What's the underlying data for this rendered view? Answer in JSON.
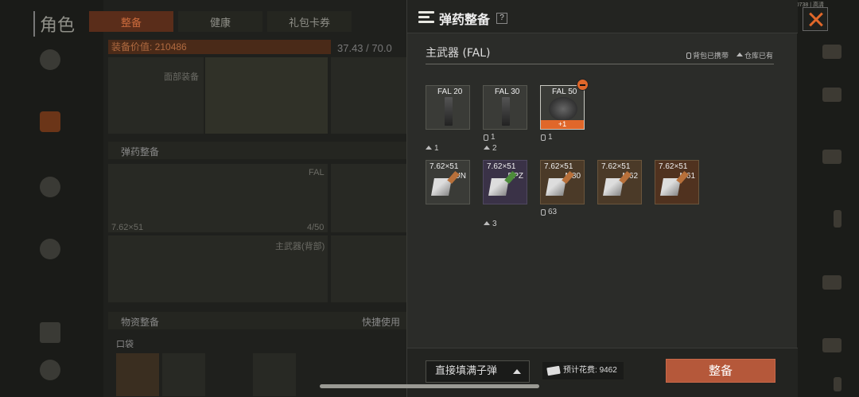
{
  "version_text": "1.0.128(7) | 09281620 | 6675670738 | 高清",
  "background": {
    "title": "角色",
    "tabs": [
      "整备",
      "健康",
      "礼包卡券"
    ],
    "equip_value": "装备价值: 210486",
    "capacity": "37.43 / 70.0",
    "face_label": "面部装备",
    "ammo_label": "弹药整备",
    "weapon_label": "FAL",
    "caliber": "7.62×51",
    "mag_count": "4/50",
    "primary_back": "主武器(背部)",
    "supplies": "物资整备",
    "quick_use": "快捷使用",
    "pocket": "口袋"
  },
  "modal": {
    "title": "弹药整备",
    "help": "?",
    "section_title": "主武器 (FAL)",
    "legend": {
      "backpack": "背包已携带",
      "warehouse": "仓库已有"
    },
    "magazines": [
      {
        "label": "FAL 20",
        "count_icon": "home",
        "count": "1"
      },
      {
        "label": "FAL 30",
        "count_icon": "bag",
        "count": "1",
        "count2_icon": "home",
        "count2": "2"
      },
      {
        "label": "FAL 50",
        "badge": "+1",
        "count_icon": "bag",
        "count": "1"
      }
    ],
    "ammo": [
      {
        "caliber": "7.62×51",
        "type": "UN"
      },
      {
        "caliber": "7.62×51",
        "type": "BPZ",
        "count_icon": "home",
        "count": "3"
      },
      {
        "caliber": "7.62×51",
        "type": "M80",
        "count_icon": "bag",
        "count": "63"
      },
      {
        "caliber": "7.62×51",
        "type": "M62"
      },
      {
        "caliber": "7.62×51",
        "type": "M61"
      }
    ],
    "footer": {
      "fill_option": "直接填满子弹",
      "cost_label": "预计花费:",
      "cost_value": "9462",
      "equip_button": "整备"
    }
  },
  "colors": {
    "accent": "#e0672a",
    "button": "#b5583a"
  }
}
